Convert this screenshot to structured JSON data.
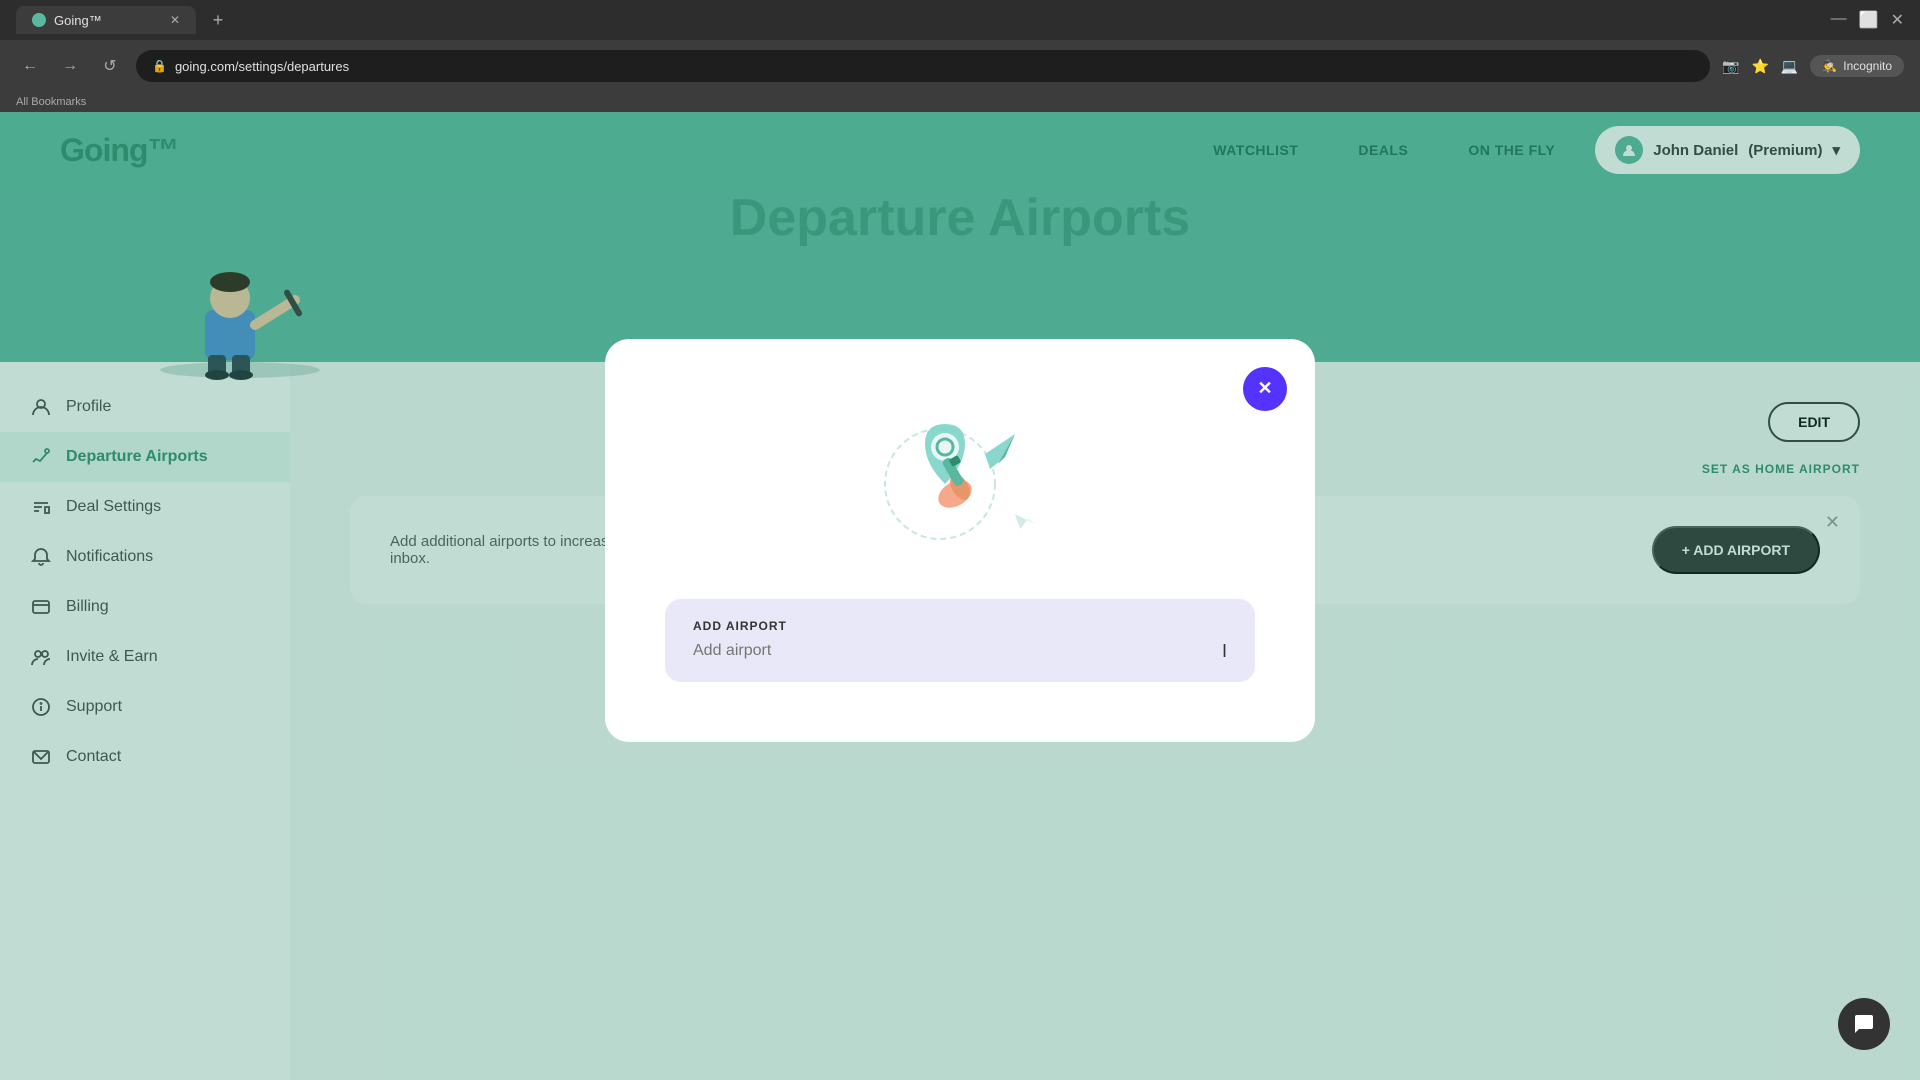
{
  "browser": {
    "tab_title": "Going™",
    "url": "going.com/settings/departures",
    "incognito_label": "Incognito",
    "bookmarks_label": "All Bookmarks",
    "new_tab_icon": "+",
    "close_icon": "✕",
    "minimize_icon": "—",
    "maximize_icon": "⬜",
    "back_icon": "←",
    "forward_icon": "→",
    "refresh_icon": "↺"
  },
  "nav": {
    "logo": "Going™",
    "links": [
      {
        "label": "WATCHLIST",
        "id": "watchlist"
      },
      {
        "label": "DEALS",
        "id": "deals"
      },
      {
        "label": "ON THE FLY",
        "id": "on-the-fly"
      }
    ],
    "user_label": "John Daniel",
    "user_badge": "(Premium)"
  },
  "page": {
    "title": "Departure Airports"
  },
  "sidebar": {
    "items": [
      {
        "label": "Profile",
        "id": "profile",
        "icon": "👤"
      },
      {
        "label": "Departure Airports",
        "id": "departure-airports",
        "icon": "✈",
        "active": true
      },
      {
        "label": "Deal Settings",
        "id": "deal-settings",
        "icon": "🏷"
      },
      {
        "label": "Notifications",
        "id": "notifications",
        "icon": "🔔"
      },
      {
        "label": "Billing",
        "id": "billing",
        "icon": "🪪"
      },
      {
        "label": "Invite & Earn",
        "id": "invite-earn",
        "icon": "👥"
      },
      {
        "label": "Support",
        "id": "support",
        "icon": "ℹ"
      },
      {
        "label": "Contact",
        "id": "contact",
        "icon": "✉"
      }
    ]
  },
  "main": {
    "edit_button": "EDIT",
    "home_airport_cta": "SET AS HOME AIRPORT",
    "add_airport_info": "Add additional airports to increase the number of deals we send to your inbox.",
    "add_airport_button": "+ ADD AIRPORT",
    "close_banner_icon": "✕"
  },
  "modal": {
    "close_icon": "✕",
    "input_label": "ADD AIRPORT",
    "input_placeholder": "Add airport",
    "cursor": "I"
  },
  "chat": {
    "icon": "💬"
  }
}
